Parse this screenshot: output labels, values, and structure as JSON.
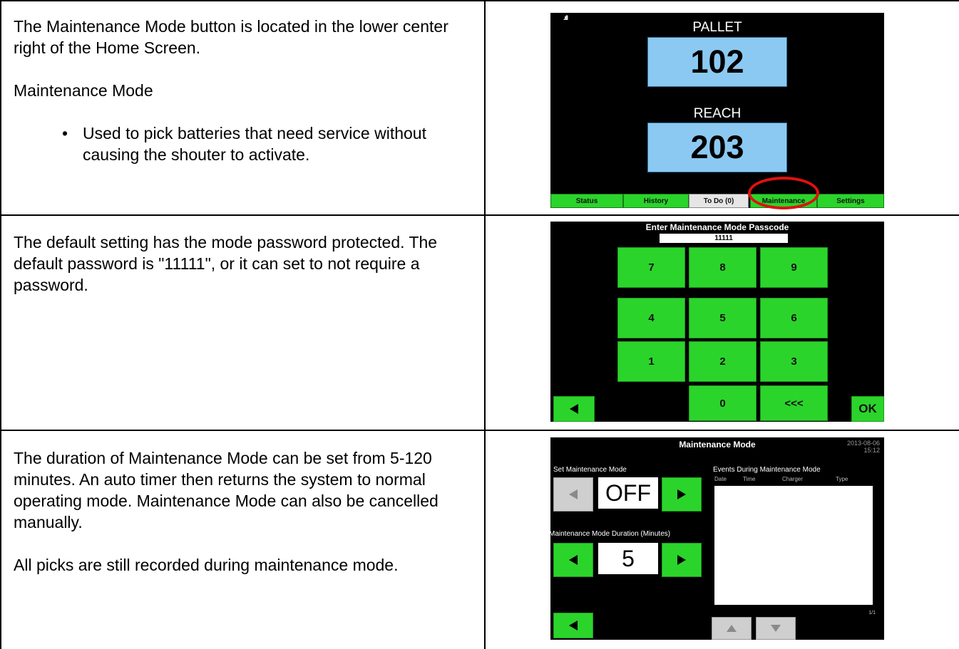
{
  "rows": [
    {
      "paragraphs": [
        "The Maintenance Mode button is located in the lower center right of the Home Screen.",
        "Maintenance Mode"
      ],
      "bullets": [
        "Used to pick batteries that need service without causing the shouter to activate."
      ]
    },
    {
      "paragraphs": [
        "The default setting has the mode password protected.  The default password is \"11111\", or it can set to not require a password."
      ]
    },
    {
      "paragraphs": [
        "The duration of Maintenance Mode can be set from 5-120 minutes.  An auto timer then returns the system to normal operating mode.  Maintenance Mode can also be cancelled manually.",
        "All picks are still recorded during maintenance mode."
      ]
    }
  ],
  "home_screen": {
    "signal": ".ıll",
    "pallet_label": "PALLET",
    "pallet_value": "102",
    "reach_label": "REACH",
    "reach_value": "203",
    "tabs": [
      "Status",
      "History",
      "To Do (0)",
      "Maintenance",
      "Settings"
    ],
    "highlight_color": "#e01010"
  },
  "passcode_screen": {
    "title": "Enter Maintenance Mode Passcode",
    "entered": "11111",
    "keys": [
      "7",
      "8",
      "9",
      "4",
      "5",
      "6",
      "1",
      "2",
      "3",
      "0",
      "<<<"
    ],
    "back_icon": "left-arrow-icon",
    "ok_label": "OK"
  },
  "maintenance_screen": {
    "title": "Maintenance Mode",
    "date": "2013-08-06",
    "time": "15:12",
    "set_label": "Set Maintenance Mode",
    "mode_value": "OFF",
    "duration_label": "Maintenance Mode Duration (Minutes)",
    "duration_value": "5",
    "events_label": "Events During Maintenance Mode",
    "columns": [
      "Date",
      "Time",
      "Charger",
      "Type"
    ],
    "page": "1/1"
  },
  "colors": {
    "button_green": "#2bd42b",
    "value_blue": "#8cc9f2",
    "screen_bg": "#000000"
  }
}
